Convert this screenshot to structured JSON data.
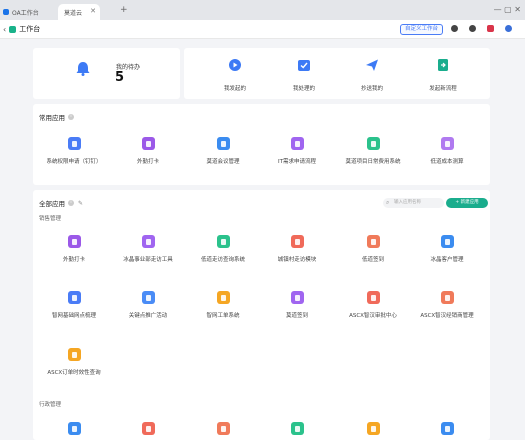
{
  "browser": {
    "tabs": [
      {
        "label": "OA工作台"
      },
      {
        "label": "莫道云"
      }
    ],
    "new_tab": "+",
    "window_controls": "—  ▢  ✕"
  },
  "header": {
    "title": "工作台",
    "custom_button": "自定义工作台"
  },
  "todo": {
    "label": "我的待办",
    "count": "5"
  },
  "flows": [
    {
      "label": "我发起的",
      "icon": "play-icon"
    },
    {
      "label": "我处理的",
      "icon": "check-icon"
    },
    {
      "label": "抄送我的",
      "icon": "send-icon"
    },
    {
      "label": "发起新流程",
      "icon": "new-flow-icon"
    }
  ],
  "common_apps": {
    "title": "常用应用",
    "items": [
      {
        "label": "系统权限申请（钉钉）",
        "color": "#4a7cf6"
      },
      {
        "label": "外勤打卡",
        "color": "#9b59e8"
      },
      {
        "label": "莫道会议管理",
        "color": "#3b8cf0"
      },
      {
        "label": "IT需求申请流程",
        "color": "#a065f0"
      },
      {
        "label": "莫道项目日常费用系统",
        "color": "#2bc28c"
      },
      {
        "label": "低道成本测算",
        "color": "#b07af0"
      }
    ]
  },
  "all_apps": {
    "title": "全部应用",
    "search_placeholder": "输入应用名称",
    "new_button": "+ 新建应用",
    "groups": [
      {
        "label": "销售管理",
        "items": [
          {
            "label": "外勤打卡",
            "color": "#9b59e8"
          },
          {
            "label": "冰晶事业部走访工具",
            "color": "#a065f0"
          },
          {
            "label": "低道走访查询系统",
            "color": "#2bc28c"
          },
          {
            "label": "城镇村走访模块",
            "color": "#f06a5a"
          },
          {
            "label": "低道签到",
            "color": "#f07a5a"
          },
          {
            "label": "冰晶客户管理",
            "color": "#3b8cf0"
          },
          {
            "label": "智网基础网点梳理",
            "color": "#4a7cf6"
          },
          {
            "label": "关键点推广活动",
            "color": "#4a8cf6"
          },
          {
            "label": "智网工单系统",
            "color": "#f5a623"
          },
          {
            "label": "莫道签到",
            "color": "#a065f0"
          },
          {
            "label": "ASCX智汉审批中心",
            "color": "#f06a5a"
          },
          {
            "label": "ASCX智汉经销商管理",
            "color": "#f07a5a"
          },
          {
            "label": "ASCX订单时效性查询",
            "color": "#f5a623"
          }
        ]
      },
      {
        "label": "行政管理",
        "items": [
          {
            "label": "",
            "color": "#3b8cf0"
          },
          {
            "label": "",
            "color": "#f06a5a"
          },
          {
            "label": "",
            "color": "#f07a5a"
          },
          {
            "label": "",
            "color": "#2bc28c"
          },
          {
            "label": "",
            "color": "#f5a623"
          },
          {
            "label": "",
            "color": "#3b8cf0"
          }
        ]
      }
    ]
  }
}
